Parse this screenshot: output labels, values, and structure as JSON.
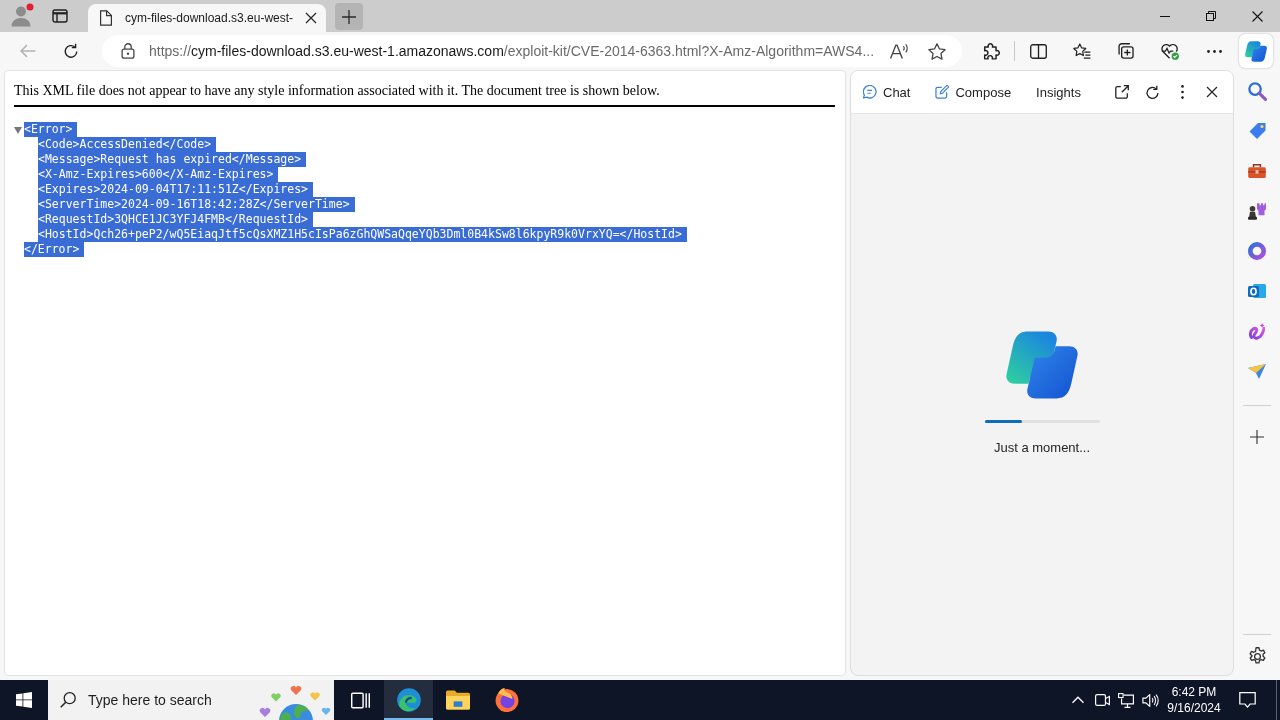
{
  "browser": {
    "tabs": [
      {
        "title": "cym-files-download.s3.eu-west-",
        "selected": true
      }
    ],
    "back_button": {
      "disabled": true
    },
    "address_bar": {
      "scheme": "https://",
      "host": "cym-files-download.s3.eu-west-1.amazonaws.com",
      "path": "/exploit-kit/CVE-2014-6363.html?X-Amz-Algorithm=AWS4..."
    }
  },
  "xml_viewer": {
    "notice": "This XML file does not appear to have any style information associated with it. The document tree is shown below.",
    "tree": {
      "expanded": true,
      "open_tag": {
        "text": "<Error>",
        "selected": true
      },
      "children": [
        {
          "text": "<Code>AccessDenied</Code>",
          "selected": true
        },
        {
          "text": "<Message>Request has expired</Message>",
          "selected": true
        },
        {
          "text": "<X-Amz-Expires>600</X-Amz-Expires>",
          "selected": true
        },
        {
          "text": "<Expires>2024-09-04T17:11:51Z</Expires>",
          "selected": true
        },
        {
          "text": "<ServerTime>2024-09-16T18:42:28Z</ServerTime>",
          "selected": true
        },
        {
          "text": "<RequestId>3QHCE1JC3YFJ4FMB</RequestId>",
          "selected": true
        },
        {
          "text": "<HostId>Qch26+peP2/wQ5EiaqJtf5cQsXMZ1H5cIsPa6zGhQWSaQqeYQb3Dml0B4kSw8l6kpyR9k0VrxYQ=</HostId>",
          "selected": true
        }
      ],
      "close_tag": {
        "text": "</Error>",
        "selected": true
      }
    }
  },
  "copilot": {
    "tabs": [
      {
        "label": "Chat",
        "kind": "chat",
        "selected": false
      },
      {
        "label": "Compose",
        "kind": "compose",
        "selected": false
      },
      {
        "label": "Insights",
        "kind": "plain",
        "selected": false
      }
    ],
    "loading": {
      "level": 0.33,
      "message": "Just a moment..."
    }
  },
  "taskbar": {
    "search": {
      "placeholder": "Type here to search"
    },
    "apps": [
      {
        "kind": "swirl",
        "selected": true
      },
      {
        "kind": "folder",
        "selected": false
      },
      {
        "kind": "fox",
        "selected": false
      }
    ],
    "clock": {
      "time": "6:42 PM",
      "date": "9/16/2024"
    }
  }
}
